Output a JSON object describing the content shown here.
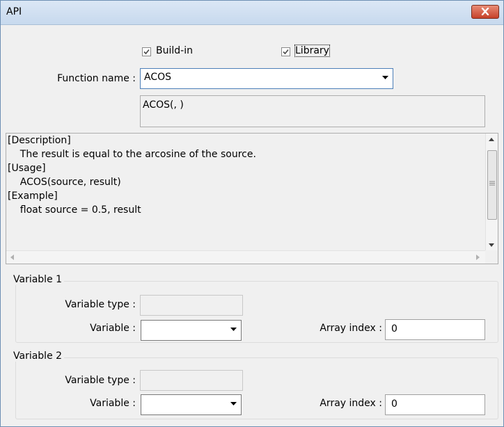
{
  "window": {
    "title": "API"
  },
  "checks": {
    "buildin_label": "Build-in",
    "buildin_checked": true,
    "library_label": "Library",
    "library_checked": true
  },
  "function": {
    "label": "Function name :",
    "value": "ACOS",
    "signature": "ACOS(, )"
  },
  "description": {
    "lines": [
      "[Description]",
      "    The result is equal to the arcosine of the source.",
      "",
      "[Usage]",
      "    ACOS(source, result)",
      "",
      "[Example]",
      "    float source = 0.5, result"
    ]
  },
  "variable1": {
    "group_title": "Variable 1",
    "type_label": "Variable type :",
    "type_value": "",
    "variable_label": "Variable :",
    "variable_value": "",
    "index_label": "Array index :",
    "index_value": "0"
  },
  "variable2": {
    "group_title": "Variable 2",
    "type_label": "Variable type :",
    "type_value": "",
    "variable_label": "Variable :",
    "variable_value": "",
    "index_label": "Array index :",
    "index_value": "0"
  },
  "icons": {
    "close": "close-icon",
    "check": "checkmark-icon",
    "dropdown": "chevron-down-icon",
    "scroll_up": "arrow-up-icon",
    "scroll_down": "arrow-down-icon",
    "scroll_left": "arrow-left-icon",
    "scroll_right": "arrow-right-icon"
  }
}
